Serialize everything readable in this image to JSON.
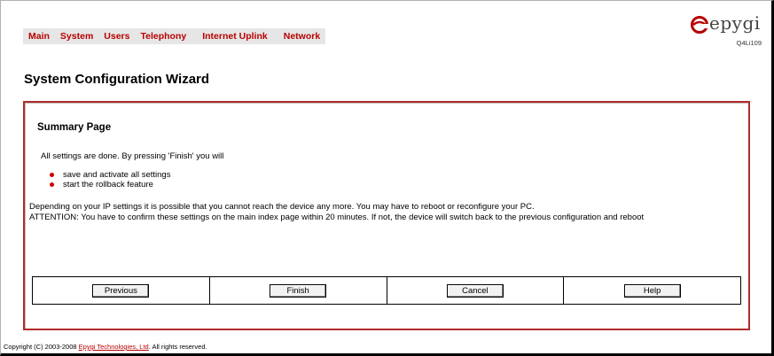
{
  "nav": {
    "items": [
      "Main",
      "System",
      "Users",
      "Telephony",
      "Internet Uplink",
      "Network"
    ]
  },
  "logo": {
    "text": "epygi",
    "model": "Q4Li109",
    "icon": "epygi-logo-icon"
  },
  "page": {
    "title": "System Configuration Wizard"
  },
  "summary": {
    "heading": "Summary Page",
    "intro": "All settings are done. By pressing 'Finish' you will",
    "bullets": [
      "save and activate all settings",
      "start the rollback feature"
    ],
    "note1": "Depending on your IP settings it is possible that you cannot reach the device any more. You may have to reboot or reconfigure your PC.",
    "note2": "ATTENTION: You have to confirm these settings on the main index page within 20 minutes. If not, the device will switch back to the previous configuration and reboot"
  },
  "buttons": {
    "previous": "Previous",
    "finish": "Finish",
    "cancel": "Cancel",
    "help": "Help"
  },
  "footer": {
    "prefix": "Copyright (C) 2003-2008 ",
    "link": "Epygi Technologies, Ltd",
    "suffix": ". All rights reserved."
  },
  "colors": {
    "nav_text": "#b80000",
    "panel_border": "#b22a2a",
    "bullet": "#cc0000"
  }
}
